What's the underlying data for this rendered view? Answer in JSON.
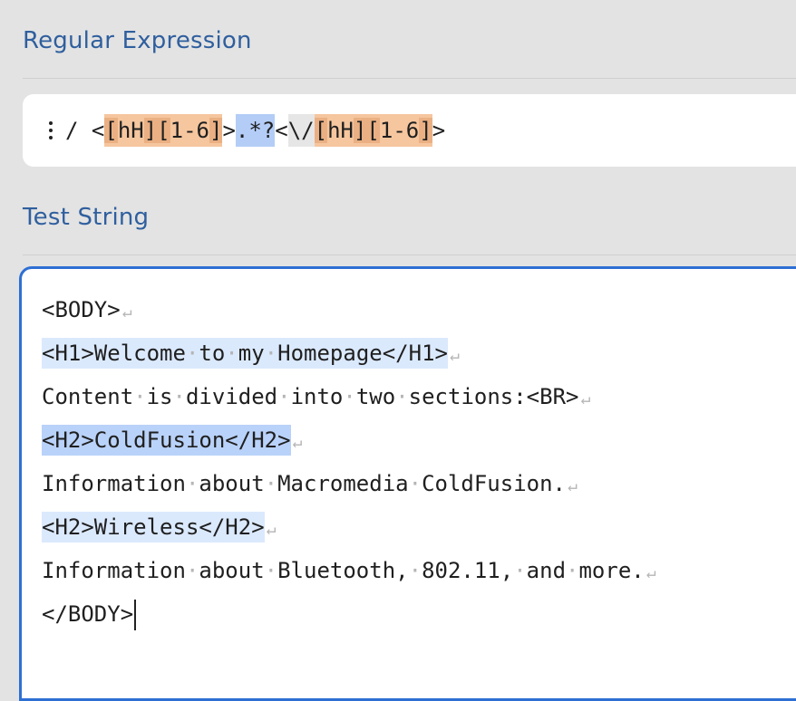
{
  "regex_section": {
    "title": "Regular Expression"
  },
  "regex": {
    "delimiter": "/",
    "tokens": [
      {
        "text": " <",
        "kind": "plain"
      },
      {
        "text": "[hH][1-6]",
        "kind": "cls"
      },
      {
        "text": ">",
        "kind": "plain"
      },
      {
        "text": ".*?",
        "kind": "quant"
      },
      {
        "text": "<",
        "kind": "plain"
      },
      {
        "text": "\\/",
        "kind": "esc"
      },
      {
        "text": "[hH][1-6]",
        "kind": "cls"
      },
      {
        "text": ">",
        "kind": "plain"
      }
    ]
  },
  "test_section": {
    "title": "Test String"
  },
  "test_string": {
    "lines": [
      {
        "text": "<BODY>",
        "match": "none"
      },
      {
        "text": "<H1>Welcome to my Homepage</H1>",
        "match": "light"
      },
      {
        "text": "Content is divided into two sections:<BR>",
        "match": "none"
      },
      {
        "text": "<H2>ColdFusion</H2>",
        "match": "strong"
      },
      {
        "text": "Information about Macromedia ColdFusion.",
        "match": "none"
      },
      {
        "text": "<H2>Wireless</H2>",
        "match": "light"
      },
      {
        "text": "Information about Bluetooth, 802.11, and more.",
        "match": "none"
      },
      {
        "text": "</BODY>",
        "match": "none",
        "caret": true
      }
    ],
    "whitespace_dot": "·",
    "newline_symbol": "↵"
  },
  "colors": {
    "accent": "#2e6fd3",
    "title": "#2f5f9e",
    "match_light": "#dbe9fd",
    "match_strong": "#b9d2f9",
    "class_token": "#f6c69e"
  }
}
